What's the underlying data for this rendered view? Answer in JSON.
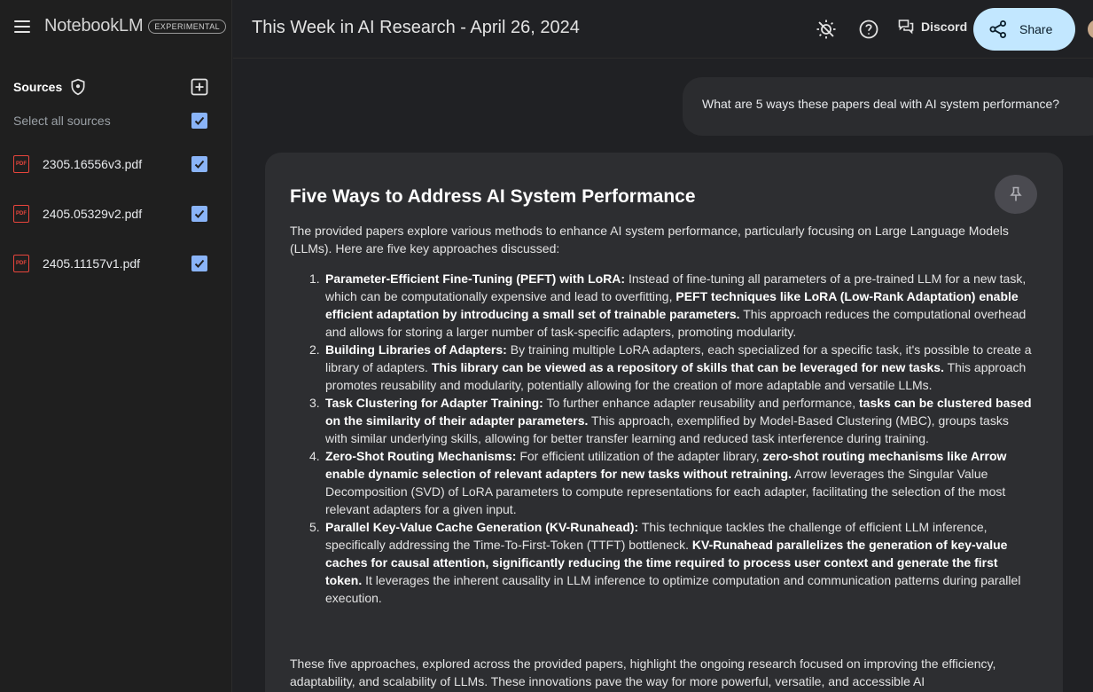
{
  "app": {
    "name": "NotebookLM",
    "badge": "EXPERIMENTAL"
  },
  "sidebar": {
    "sources_title": "Sources",
    "select_all_label": "Select all sources",
    "sources": [
      {
        "name": "2305.16556v3.pdf",
        "icon": "pdf-icon"
      },
      {
        "name": "2405.05329v2.pdf",
        "icon": "pdf-icon"
      },
      {
        "name": "2405.11157v1.pdf",
        "icon": "pdf-icon"
      }
    ]
  },
  "header": {
    "title": "This Week in AI Research - April 26, 2024",
    "discord_label": "Discord",
    "share_label": "Share"
  },
  "chat": {
    "user_question": "What are 5 ways these papers deal with AI system performance?",
    "answer_title": "Five Ways to Address AI System Performance",
    "answer_intro": "The provided papers explore various methods to enhance AI system performance, particularly focusing on Large Language Models (LLMs). Here are five key approaches discussed:",
    "answer_items": [
      {
        "num": "1.",
        "head": "Parameter-Efficient Fine-Tuning (PEFT) with LoRA:",
        "text1": " Instead of fine-tuning all parameters of a pre-trained LLM for a new task, which can be computationally expensive and lead to overfitting, ",
        "bold2": "PEFT techniques like LoRA (Low-Rank Adaptation) enable efficient adaptation by introducing a small set of trainable parameters.",
        "text2": " This approach reduces the computational overhead and allows for storing a larger number of task-specific adapters, promoting modularity."
      },
      {
        "num": "2.",
        "head": "Building Libraries of Adapters:",
        "text1": " By training multiple LoRA adapters, each specialized for a specific task, it's possible to create a library of adapters. ",
        "bold2": "This library can be viewed as a repository of skills that can be leveraged for new tasks.",
        "text2": " This approach promotes reusability and modularity, potentially allowing for the creation of more adaptable and versatile LLMs."
      },
      {
        "num": "3.",
        "head": "Task Clustering for Adapter Training:",
        "text1": " To further enhance adapter reusability and performance, ",
        "bold2": "tasks can be clustered based on the similarity of their adapter parameters.",
        "text2": " This approach, exemplified by Model-Based Clustering (MBC), groups tasks with similar underlying skills, allowing for better transfer learning and reduced task interference during training."
      },
      {
        "num": "4.",
        "head": "Zero-Shot Routing Mechanisms:",
        "text1": " For efficient utilization of the adapter library, ",
        "bold2": "zero-shot routing mechanisms like Arrow enable dynamic selection of relevant adapters for new tasks without retraining.",
        "text2": " Arrow leverages the Singular Value Decomposition (SVD) of LoRA parameters to compute representations for each adapter, facilitating the selection of the most relevant adapters for a given input."
      },
      {
        "num": "5.",
        "head": "Parallel Key-Value Cache Generation (KV-Runahead):",
        "text1": " This technique tackles the challenge of efficient LLM inference, specifically addressing the Time-To-First-Token (TTFT) bottleneck. ",
        "bold2": "KV-Runahead parallelizes the generation of key-value caches for causal attention, significantly reducing the time required to process user context and generate the first token.",
        "text2": " It leverages the inherent causality in LLM inference to optimize computation and communication patterns during parallel execution."
      }
    ],
    "answer_outro": "These five approaches, explored across the provided papers, highlight the ongoing research focused on improving the efficiency, adaptability, and scalability of LLMs. These innovations pave the way for more powerful, versatile, and accessible AI"
  },
  "colors": {
    "background": "#202124",
    "sidebar": "#1f1f1f",
    "card": "#2d2e31",
    "accent_checkbox": "#8ab4f8",
    "share_button": "#c2e7ff",
    "pdf_red": "#e8453c"
  }
}
